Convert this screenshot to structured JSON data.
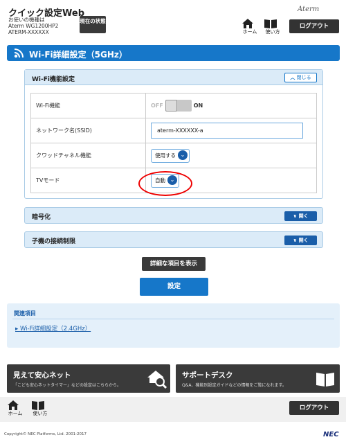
{
  "header": {
    "title": "クイック設定Web",
    "device_line1": "お使いの機種は",
    "device_line2": "Aterm WG1200HP2",
    "device_line3": "ATERM-XXXXXX",
    "status_button": "現在の状態",
    "brand": "Aterm",
    "home_label": "ホーム",
    "manual_label": "使い方",
    "logout_label": "ログアウト"
  },
  "page": {
    "title": "Wi-Fi詳細設定（5GHz）"
  },
  "wifi_section": {
    "title": "Wi-Fi機能設定",
    "collapse_label": "閉じる",
    "rows": [
      {
        "label": "Wi-Fi機能",
        "off": "OFF",
        "on": "ON"
      },
      {
        "label": "ネットワーク名(SSID)",
        "value": "aterm-XXXXXX-a"
      },
      {
        "label": "クワッドチャネル機能",
        "value": "使用する"
      },
      {
        "label": "TVモード",
        "value": "自動"
      }
    ]
  },
  "encryption": {
    "title": "暗号化",
    "open_label": "開く"
  },
  "child_limit": {
    "title": "子機の接続制限",
    "open_label": "開く"
  },
  "buttons": {
    "show_detail": "詳細な項目を表示",
    "submit": "設定"
  },
  "related": {
    "heading": "関連項目",
    "link": "Wi-Fi詳細設定（2.4GHz）"
  },
  "banners": [
    {
      "title": "見えて安心ネット",
      "subtitle": "「こども安心ネットタイマー」などの設定はこちらから。",
      "icon": "house-search-icon"
    },
    {
      "title": "サポートデスク",
      "subtitle": "Q&A、機能別設定ガイドなどの情報をご覧になれます。",
      "icon": "book-icon"
    }
  ],
  "footer": {
    "home_label": "ホーム",
    "manual_label": "使い方",
    "logout_label": "ログアウト",
    "copyright": "Copyright© NEC Platforms, Ltd. 2001-2017",
    "logo": "NEC"
  },
  "colors": {
    "primary_blue": "#1677c9",
    "dark_button": "#3a3a3a",
    "panel_bg": "#dbebf8",
    "highlight_ring": "#e00000"
  }
}
